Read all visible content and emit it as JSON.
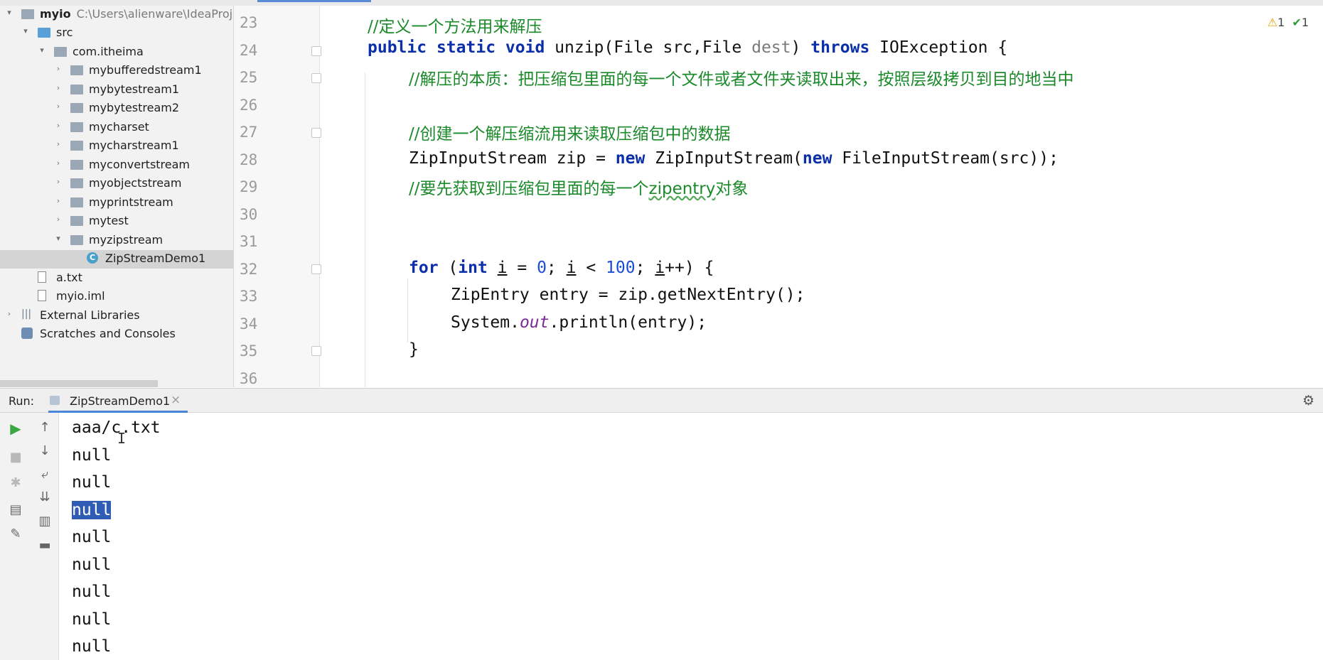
{
  "project": {
    "name": "myio",
    "path": "C:\\Users\\alienware\\IdeaProje",
    "items": [
      {
        "label": "src",
        "type": "folder-blue",
        "indent": 1,
        "arrow": "open"
      },
      {
        "label": "com.itheima",
        "type": "folder",
        "indent": 2,
        "arrow": "open"
      },
      {
        "label": "mybufferedstream1",
        "type": "folder",
        "indent": 3,
        "arrow": "closed"
      },
      {
        "label": "mybytestream1",
        "type": "folder",
        "indent": 3,
        "arrow": "closed"
      },
      {
        "label": "mybytestream2",
        "type": "folder",
        "indent": 3,
        "arrow": "closed"
      },
      {
        "label": "mycharset",
        "type": "folder",
        "indent": 3,
        "arrow": "closed"
      },
      {
        "label": "mycharstream1",
        "type": "folder",
        "indent": 3,
        "arrow": "closed"
      },
      {
        "label": "myconvertstream",
        "type": "folder",
        "indent": 3,
        "arrow": "closed"
      },
      {
        "label": "myobjectstream",
        "type": "folder",
        "indent": 3,
        "arrow": "closed"
      },
      {
        "label": "myprintstream",
        "type": "folder",
        "indent": 3,
        "arrow": "closed"
      },
      {
        "label": "mytest",
        "type": "folder",
        "indent": 3,
        "arrow": "closed"
      },
      {
        "label": "myzipstream",
        "type": "folder",
        "indent": 3,
        "arrow": "open"
      },
      {
        "label": "ZipStreamDemo1",
        "type": "class",
        "indent": 4,
        "arrow": "",
        "selected": true
      },
      {
        "label": "a.txt",
        "type": "file",
        "indent": 1,
        "arrow": ""
      },
      {
        "label": "myio.iml",
        "type": "file",
        "indent": 1,
        "arrow": ""
      },
      {
        "label": "External Libraries",
        "type": "lib",
        "indent": 0,
        "arrow": "closed"
      },
      {
        "label": "Scratches and Consoles",
        "type": "scratch",
        "indent": 0,
        "arrow": ""
      }
    ]
  },
  "editor": {
    "line_numbers": [
      "23",
      "24",
      "25",
      "26",
      "27",
      "28",
      "29",
      "30",
      "31",
      "32",
      "33",
      "34",
      "35",
      "36"
    ],
    "code": {
      "l23": "//定义一个方法用来解压",
      "l24_public": "public",
      "l24_static": "static",
      "l24_void": "void",
      "l24_sig": "unzip(File src,File ",
      "l24_dest": "dest",
      "l24_close": ")",
      "l24_throws": "throws",
      "l24_tail": "IOException {",
      "l25": "//解压的本质：把压缩包里面的每一个文件或者文件夹读取出来，按照层级拷贝到目的地当中",
      "l27": "//创建一个解压缩流用来读取压缩包中的数据",
      "l28_a": "ZipInputStream zip = ",
      "l28_new1": "new",
      "l28_b": " ZipInputStream(",
      "l28_new2": "new",
      "l28_c": " FileInputStream(src));",
      "l29_a": "//要先获取到压缩包里面的每一个",
      "l29_b": "zipentry",
      "l29_c": "对象",
      "l32_for": "for",
      "l32_p1": " (",
      "l32_int": "int",
      "l32_i1": "i",
      "l32_eq": " = ",
      "l32_zero": "0",
      "l32_semi1": "; ",
      "l32_i2": "i",
      "l32_lt": " < ",
      "l32_hundred": "100",
      "l32_semi2": "; ",
      "l32_i3": "i",
      "l32_end": "++) {",
      "l33": "ZipEntry entry = zip.getNextEntry();",
      "l34_a": "System.",
      "l34_out": "out",
      "l34_b": ".println(entry);",
      "l35": "}"
    },
    "inspections": {
      "warnings": "1",
      "weak_warnings": "1"
    }
  },
  "run": {
    "label": "Run:",
    "tab": "ZipStreamDemo1",
    "output": [
      "aaa/c.txt",
      "null",
      "null",
      "null",
      "null",
      "null",
      "null",
      "null",
      "null"
    ],
    "selected_line": 3
  },
  "icons": {
    "arrow_open": "▾",
    "arrow_closed": "›",
    "warning": "⚠",
    "weak": "✔",
    "play": "▶",
    "stop": "■",
    "up": "↑",
    "down": "↓",
    "gear": "⚙",
    "close": "×",
    "cursor": "I",
    "class_letter": "C"
  }
}
